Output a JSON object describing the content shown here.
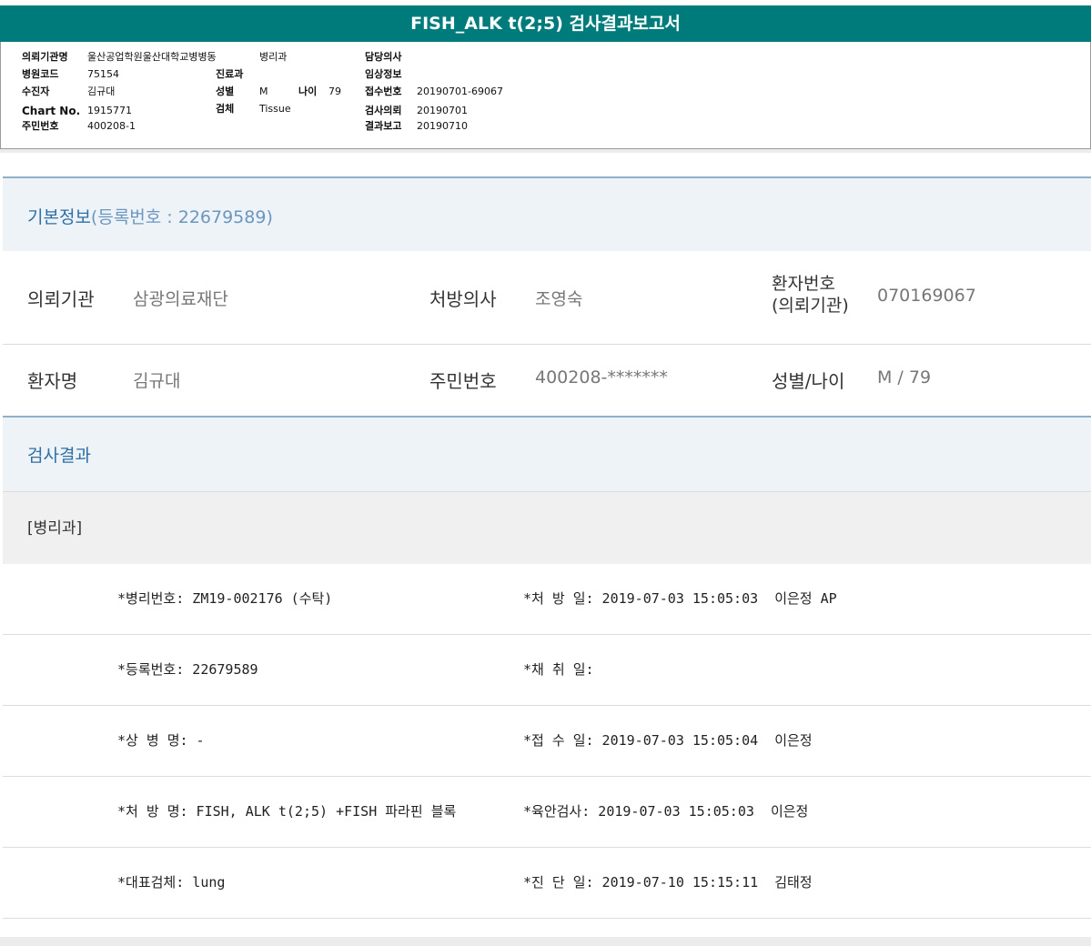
{
  "report": {
    "title": "FISH_ALK t(2;5) 검사결과보고서",
    "col1": [
      {
        "label": "의뢰기관명",
        "value": "울산공업학원울산대학교병병동"
      },
      {
        "label": "병원코드",
        "value": "75154"
      },
      {
        "label": "수진자",
        "value": "김규대"
      },
      {
        "label": "Chart No.",
        "value": "1915771"
      },
      {
        "label": "주민번호",
        "value": "400208-1"
      }
    ],
    "dept_value": "병리과",
    "col2": {
      "clinic_label": "진료과",
      "sex_label": "성별",
      "sex_value": "M",
      "age_label": "나이",
      "age_value": "79",
      "specimen_label": "검체",
      "specimen_value": "Tissue"
    },
    "col3": [
      {
        "label": "담당의사",
        "value": ""
      },
      {
        "label": "임상정보",
        "value": ""
      },
      {
        "label": "접수번호",
        "value": "20190701-69067"
      },
      {
        "label": "검사의뢰",
        "value": "20190701"
      },
      {
        "label": "결과보고",
        "value": "20190710"
      }
    ]
  },
  "basic": {
    "title": "기본정보",
    "reg": "(등록번호 : 22679589)",
    "row1": {
      "inst_label": "의뢰기관",
      "inst_value": "삼광의료재단",
      "doctor_label": "처방의사",
      "doctor_value": "조영숙",
      "patno_label_1": "환자번호",
      "patno_label_2": "(의뢰기관)",
      "patno_value": "070169067"
    },
    "row2": {
      "name_label": "환자명",
      "name_value": "김규대",
      "rrn_label": "주민번호",
      "rrn_value": "400208-*******",
      "sexage_label": "성별/나이",
      "sexage_value": "M / 79"
    }
  },
  "results": {
    "title": "검사결과",
    "dept": "[병리과]",
    "rows": [
      {
        "left": "*병리번호: ZM19-002176 (수탁)",
        "right": "*처 방 일: 2019-07-03 15:05:03  이은정 AP"
      },
      {
        "left": "*등록번호: 22679589",
        "right": "*채 취 일:"
      },
      {
        "left": "*상 병 명: -",
        "right": "*접 수 일: 2019-07-03 15:05:04  이은정"
      },
      {
        "left": "*처 방 명: FISH, ALK t(2;5) +FISH 파라핀 블록",
        "right": "*육안검사: 2019-07-03 15:05:03  이은정"
      },
      {
        "left": "*대표검체: lung",
        "right": "*진 단 일: 2019-07-10 15:15:11  김태정"
      }
    ]
  },
  "colors": {
    "header_teal": "#007b7b",
    "section_blue": "#2e6fa6",
    "band_bg": "#eef3f7"
  }
}
